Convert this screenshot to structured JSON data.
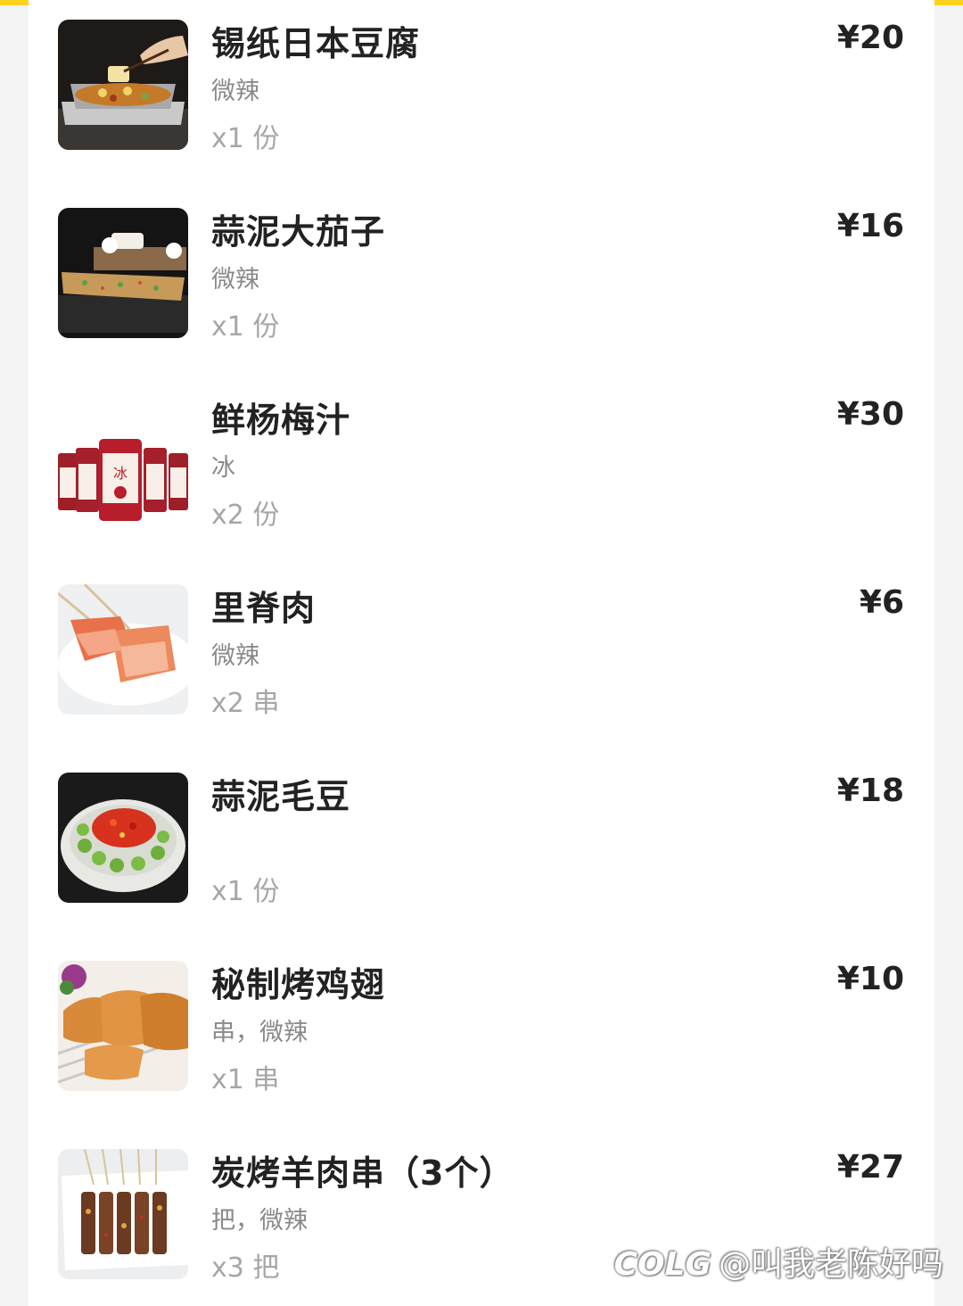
{
  "order_items": [
    {
      "name": "锡纸日本豆腐",
      "spec": "微辣",
      "quantity": "x1 份",
      "price": "¥20",
      "image": "tofu-foil-tray-image"
    },
    {
      "name": "蒜泥大茄子",
      "spec": "微辣",
      "quantity": "x1 份",
      "price": "¥16",
      "image": "grilled-eggplant-image"
    },
    {
      "name": "鲜杨梅汁",
      "spec": "冰",
      "quantity": "x2 份",
      "price": "¥30",
      "image": "bayberry-juice-bottles-image"
    },
    {
      "name": "里脊肉",
      "spec": "微辣",
      "quantity": "x2 串",
      "price": "¥6",
      "image": "pork-tenderloin-skewers-image"
    },
    {
      "name": "蒜泥毛豆",
      "spec": "",
      "quantity": "x1 份",
      "price": "¥18",
      "image": "edamame-bowl-image"
    },
    {
      "name": "秘制烤鸡翅",
      "spec": "串，微辣",
      "quantity": "x1 串",
      "price": "¥10",
      "image": "grilled-chicken-wings-image"
    },
    {
      "name": "炭烤羊肉串（3个）",
      "spec": "把，微辣",
      "quantity": "x3 把",
      "price": "¥27",
      "image": "lamb-skewers-image"
    }
  ],
  "watermark": {
    "logo": "COLG",
    "text": "@叫我老陈好吗"
  },
  "colors": {
    "accent": "#ffd21f",
    "text_primary": "#222222",
    "text_secondary": "#8a8a8a",
    "text_muted": "#a6a6a6"
  }
}
